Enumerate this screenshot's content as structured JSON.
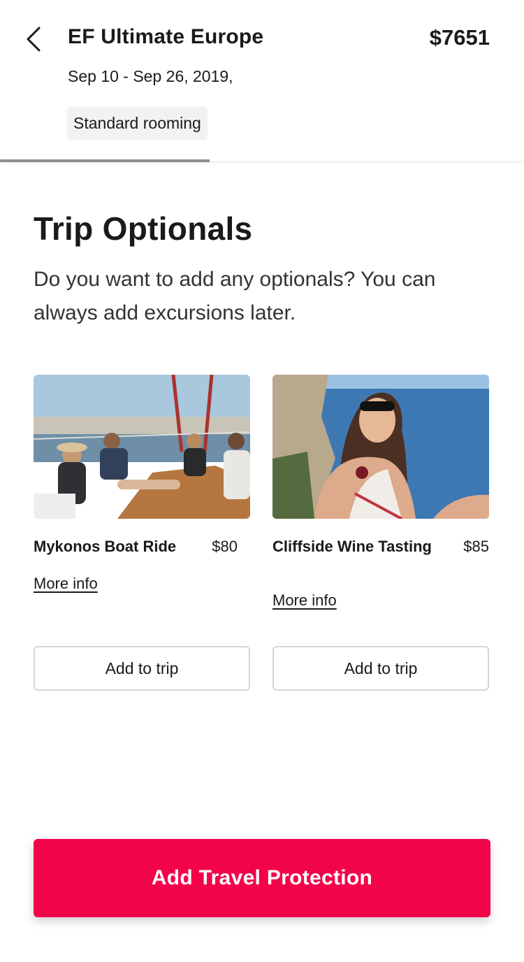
{
  "header": {
    "title": "EF Ultimate Europe",
    "price": "$7651",
    "dates": "Sep 10 - Sep 26, 2019,",
    "rooming": "Standard rooming",
    "progress_fraction": 0.4
  },
  "section": {
    "title": "Trip Optionals",
    "description": "Do you want to add any optionals? You can always add excursions later."
  },
  "optionals": [
    {
      "name": "Mykonos Boat Ride",
      "price": "$80",
      "more_info": "More info",
      "add_label": "Add to trip"
    },
    {
      "name": "Cliffside Wine Tasting",
      "price": "$85",
      "more_info": "More info",
      "add_label": "Add to trip"
    }
  ],
  "cta": {
    "label": "Add Travel Protection"
  },
  "colors": {
    "accent": "#f2044b",
    "text": "#1a1a1a",
    "badge_bg": "#f2f2f2"
  }
}
